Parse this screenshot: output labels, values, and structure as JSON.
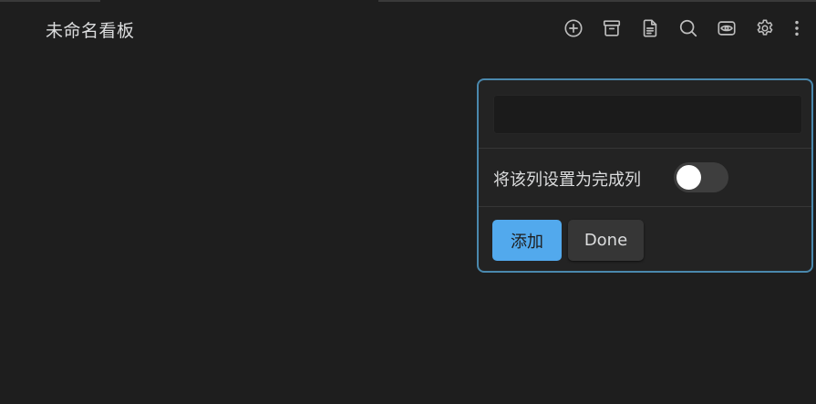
{
  "board": {
    "title": "未命名看板"
  },
  "toolbar": {
    "icons": [
      "add-icon",
      "archive-icon",
      "document-icon",
      "search-icon",
      "eye-icon",
      "gear-icon",
      "more-icon"
    ]
  },
  "new_column_popover": {
    "name_input_value": "",
    "name_input_placeholder": "",
    "complete_toggle_label": "将该列设置为完成列",
    "complete_toggle_on": false,
    "add_label": "添加",
    "done_label": "Done"
  },
  "colors": {
    "background": "#1e1e1e",
    "popover_border": "#4a88ad",
    "accent_button": "#52a9ed"
  }
}
